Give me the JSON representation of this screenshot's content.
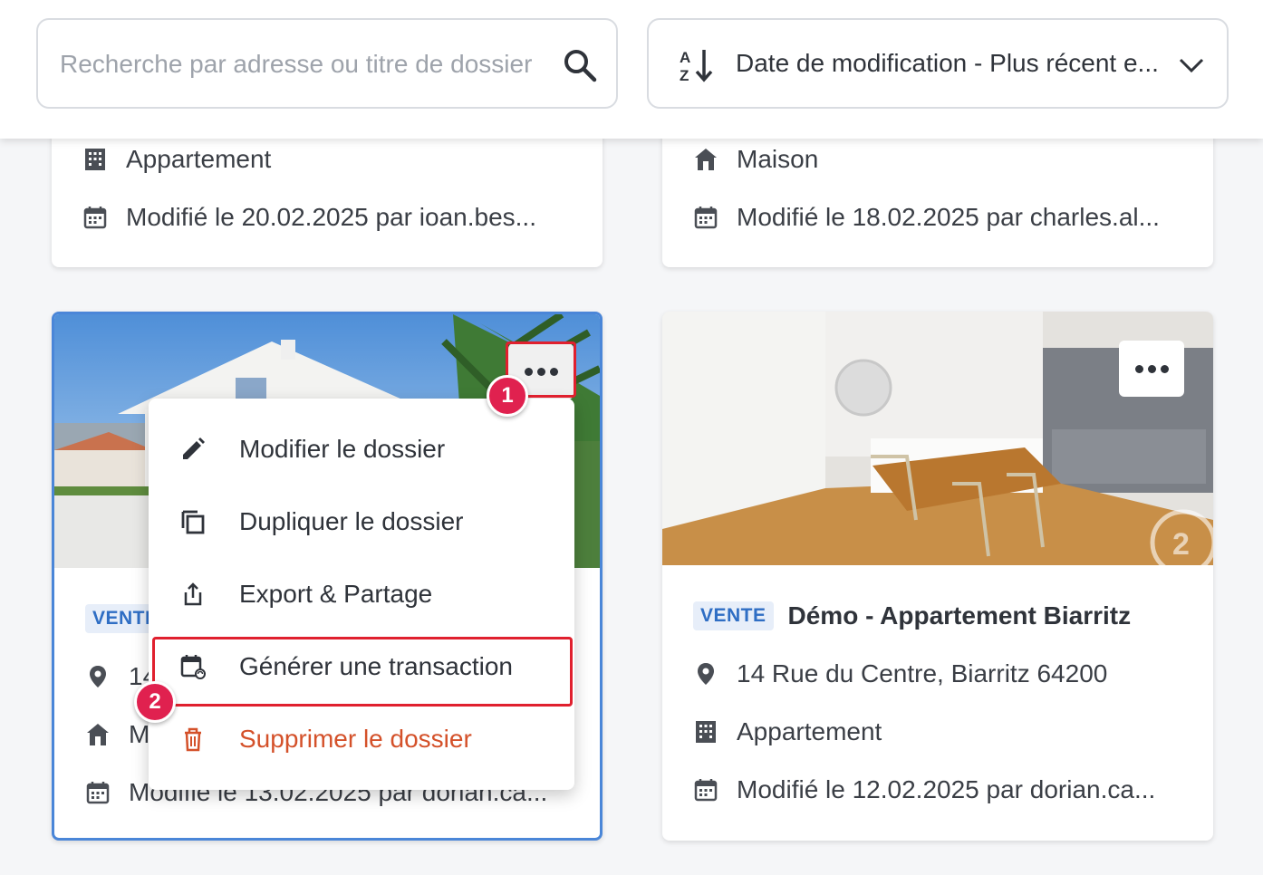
{
  "search": {
    "placeholder": "Recherche par adresse ou titre de dossier"
  },
  "sort": {
    "label": "Date de modification - Plus récent e..."
  },
  "top_cards": [
    {
      "type": "Appartement",
      "modified": "Modifié le 20.02.2025 par ioan.bes..."
    },
    {
      "type": "Maison",
      "modified": "Modifié le 18.02.2025 par charles.al..."
    }
  ],
  "selected_card": {
    "badge": "VENTE",
    "address_partial": "14",
    "type_partial": "M",
    "modified": "Modifié le 13.02.2025 par dorian.ca..."
  },
  "demo_card": {
    "badge": "VENTE",
    "title": "Démo - Appartement Biarritz",
    "address": "14 Rue du Centre, Biarritz 64200",
    "type": "Appartement",
    "modified": "Modifié le 12.02.2025 par dorian.ca...",
    "watermark": "2"
  },
  "menu": {
    "items": [
      {
        "label": "Modifier le dossier",
        "icon": "pencil-icon"
      },
      {
        "label": "Dupliquer le dossier",
        "icon": "copy-icon"
      },
      {
        "label": "Export & Partage",
        "icon": "share-icon"
      },
      {
        "label": "Générer une transaction",
        "icon": "calendar-sync-icon"
      },
      {
        "label": "Supprimer le dossier",
        "icon": "trash-icon",
        "color": "#d4512a"
      }
    ]
  },
  "steps": [
    "1",
    "2"
  ],
  "colors": {
    "accent": "#4a86d8",
    "highlight": "#e0202e",
    "step_badge": "#e0214f",
    "danger": "#d4512a",
    "badge_bg": "#e7eef9",
    "badge_text": "#2f6ec4"
  }
}
